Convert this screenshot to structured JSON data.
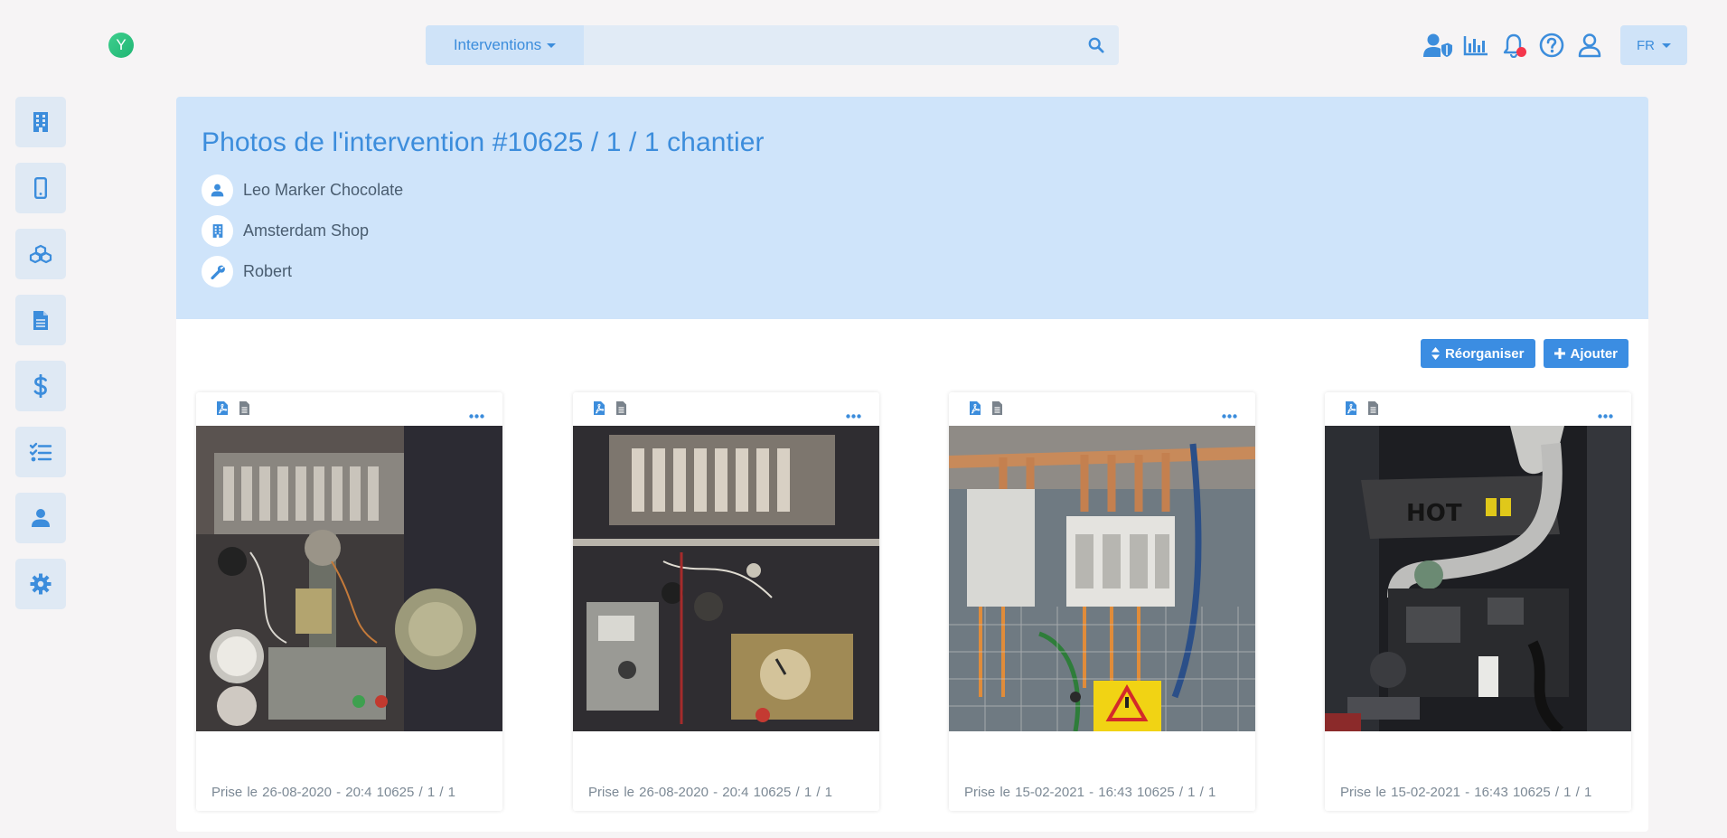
{
  "app": {
    "logo_letter": "Y"
  },
  "search": {
    "scope_label": "Interventions",
    "placeholder": ""
  },
  "lang": {
    "label": "FR"
  },
  "header": {
    "title": "Photos de l'intervention #10625 / 1 / 1 chantier",
    "client": "Leo Marker Chocolate",
    "site": "Amsterdam Shop",
    "technician": "Robert"
  },
  "actions": {
    "reorganize_label": "Réorganiser",
    "add_label": "Ajouter"
  },
  "photos": [
    {
      "caption": "Prise le 26-08-2020 - 20:4  10625 / 1 / 1"
    },
    {
      "caption": "Prise le 26-08-2020 - 20:4  10625 / 1 / 1"
    },
    {
      "caption": "Prise le 15-02-2021 - 16:43  10625 / 1 / 1"
    },
    {
      "caption": "Prise le 15-02-2021 - 16:43  10625 / 1 / 1"
    }
  ],
  "colors": {
    "accent": "#3c8ddc",
    "button": "#3b8de2",
    "header_bg": "#cfe4fa",
    "sidebar_btn": "#dfe9f4",
    "notification": "#f4364c",
    "logo": "#2ec27e"
  },
  "icons": {
    "sidebar": [
      "building-icon",
      "mobile-icon",
      "cubes-icon",
      "document-icon",
      "dollar-icon",
      "checklist-icon",
      "user-icon",
      "gear-icon"
    ],
    "top": [
      "user-shield-icon",
      "chart-icon",
      "bell-icon",
      "help-icon",
      "profile-icon"
    ]
  }
}
